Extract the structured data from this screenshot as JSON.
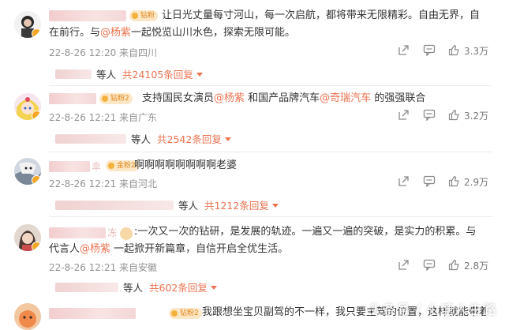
{
  "comments": [
    {
      "badge": "钻粉",
      "segments": [
        "让日光丈量每寸河山，每一次启航，都将带来无限精彩。自由无界，自在前行。与",
        "@杨紫",
        "一起悦览山川水色，探索无限可能。"
      ],
      "meta": "22-8-26 12:20 来自四川",
      "likes": "3.3万",
      "reply_people": "等人",
      "reply_count": "共24105条回复"
    },
    {
      "badge": "钻粉2",
      "segments": [
        "支持国民女演员",
        "@杨紫",
        " 和国产品牌汽车",
        "@奇瑞汽车",
        " 的强强联合"
      ],
      "meta": "22-8-26 12:21 来自广东",
      "likes": "3.2万",
      "reply_people": "等人",
      "reply_count": "共2542条回复"
    },
    {
      "name_suffix": "幸",
      "badge": "金粉2",
      "segments": [
        "啊啊啊啊啊啊啊啊老婆"
      ],
      "meta": "22-8-26 12:21 来自河北",
      "likes": "2.9万",
      "reply_people": "等人",
      "reply_count": "共1212条回复"
    },
    {
      "name_suffix": "冻",
      "segments": [
        ":一次又一次的钻研，是发展的轨迹。一遍又一遍的突破，是实力的积累。与代言人",
        "@杨紫",
        " 一起掀开新篇章，自信开启全优生活。"
      ],
      "meta": "22-8-26 12:21 来自安徽",
      "likes": "2.8万",
      "reply_people": "等人",
      "reply_count": "共602条回复"
    },
    {
      "badge": "钻粉2",
      "segments": [
        "我跟想坐宝贝副驾的不一样，我只要主驾的位置，这样就能带着你私"
      ]
    }
  ],
  "watermark": "头条号 / 小塘人生路",
  "colors": {
    "mention": "#eb7350",
    "meta": "#939393",
    "badge_bg": "#fbe7c6"
  }
}
